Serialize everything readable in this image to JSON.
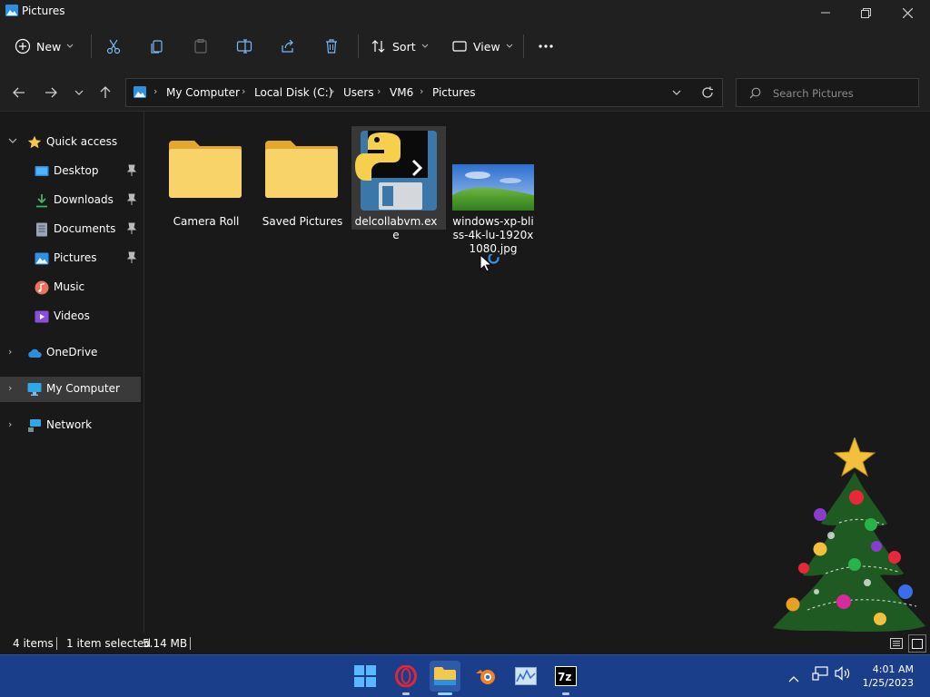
{
  "window": {
    "title": "Pictures"
  },
  "toolbar": {
    "new_label": "New",
    "sort_label": "Sort",
    "view_label": "View"
  },
  "breadcrumb": [
    "My Computer",
    "Local Disk (C:)",
    "Users",
    "VM6",
    "Pictures"
  ],
  "search": {
    "placeholder": "Search Pictures"
  },
  "nav": {
    "quick_access": "Quick access",
    "items": [
      {
        "label": "Desktop",
        "icon": "desktop-icon",
        "pinned": true
      },
      {
        "label": "Downloads",
        "icon": "download-icon",
        "pinned": true
      },
      {
        "label": "Documents",
        "icon": "document-icon",
        "pinned": true
      },
      {
        "label": "Pictures",
        "icon": "pictures-icon",
        "pinned": true
      },
      {
        "label": "Music",
        "icon": "music-icon",
        "pinned": false
      },
      {
        "label": "Videos",
        "icon": "videos-icon",
        "pinned": false
      }
    ],
    "onedrive": "OneDrive",
    "my_computer": "My Computer",
    "network": "Network"
  },
  "files": [
    {
      "name": "Camera Roll",
      "type": "folder"
    },
    {
      "name": "Saved Pictures",
      "type": "folder"
    },
    {
      "name": "delcollabvm.exe",
      "type": "exe",
      "selected": true
    },
    {
      "name": "windows-xp-bliss-4k-lu-1920x1080.jpg",
      "type": "image"
    }
  ],
  "status": {
    "count": "4 items",
    "selection": "1 item selected",
    "size": "5.14 MB"
  },
  "clock": {
    "time": "4:01 AM",
    "date": "1/25/2023"
  },
  "colors": {
    "accent": "#60cdff",
    "folder": "#f4c84a",
    "taskbar": "#1a3e8a"
  }
}
